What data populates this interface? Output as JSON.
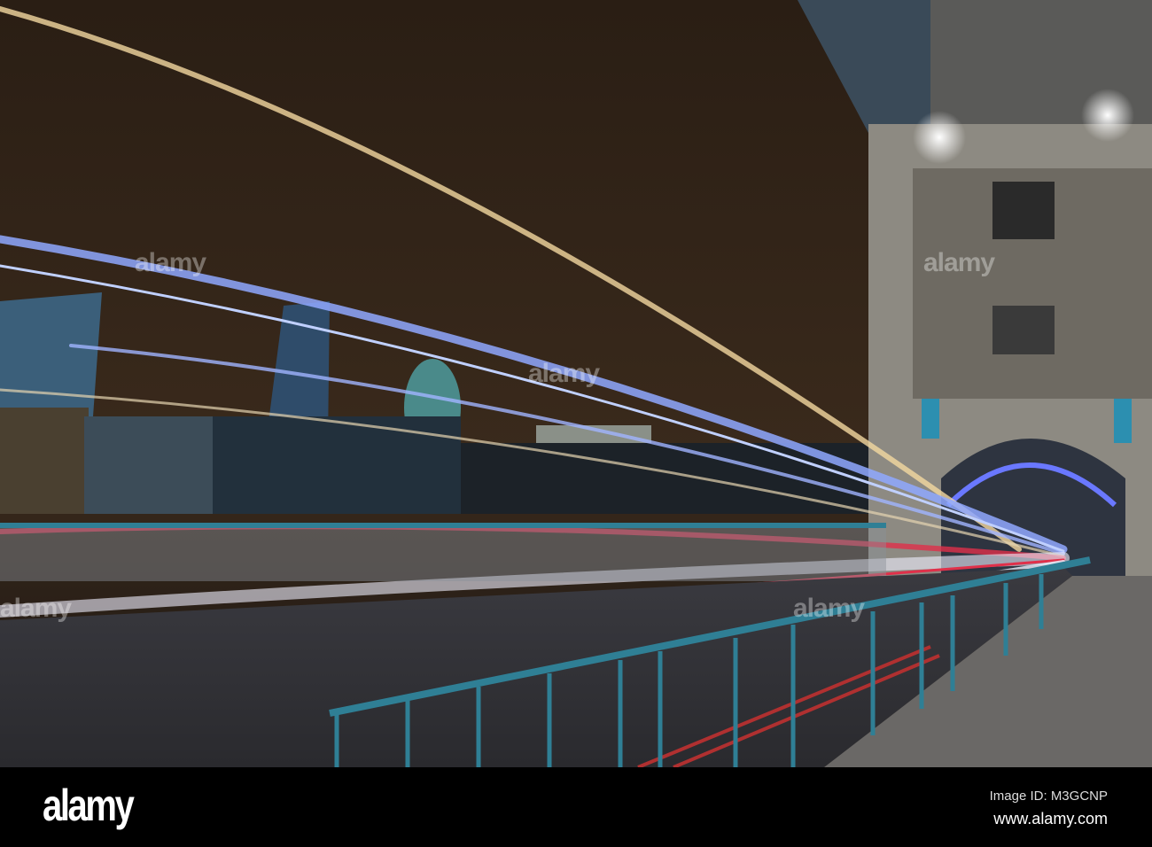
{
  "footer": {
    "logo": "alamy",
    "image_id": "Image ID: M3GCNP",
    "website": "www.alamy.com"
  },
  "watermark": "alamy",
  "colors": {
    "sky": "#2a1e14",
    "railing": "#2f7f95",
    "trail_blue": "#8fa8ff",
    "trail_red": "#e0304a",
    "trail_gold": "#f4d8a0"
  }
}
